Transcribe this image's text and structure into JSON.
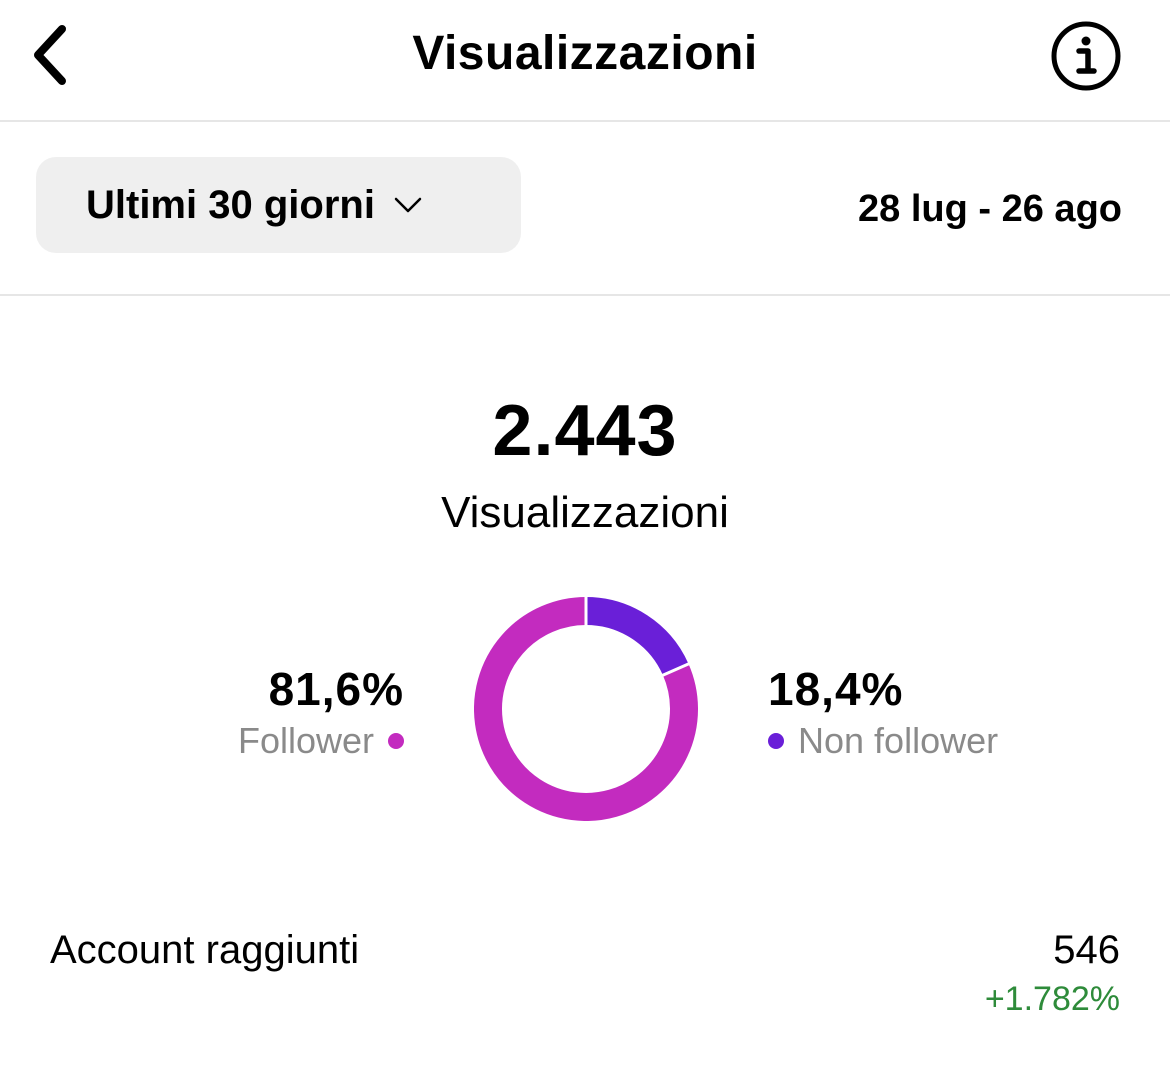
{
  "header": {
    "title": "Visualizzazioni",
    "back_icon": "chevron-left-icon",
    "info_icon": "info-icon"
  },
  "filter": {
    "range_label": "Ultimi 30 giorni",
    "date_range": "28 lug - 26 ago"
  },
  "summary": {
    "total": "2.443",
    "label": "Visualizzazioni"
  },
  "breakdown": {
    "follower": {
      "pct_text": "81,6%",
      "label": "Follower",
      "value": 81.6,
      "color": "#c32bbf"
    },
    "non_follower": {
      "pct_text": "18,4%",
      "label": "Non follower",
      "value": 18.4,
      "color": "#6a1fd8"
    }
  },
  "metric": {
    "label": "Account raggiunti",
    "value": "546",
    "change": "+1.782%",
    "change_color": "#2e8b3a"
  }
}
